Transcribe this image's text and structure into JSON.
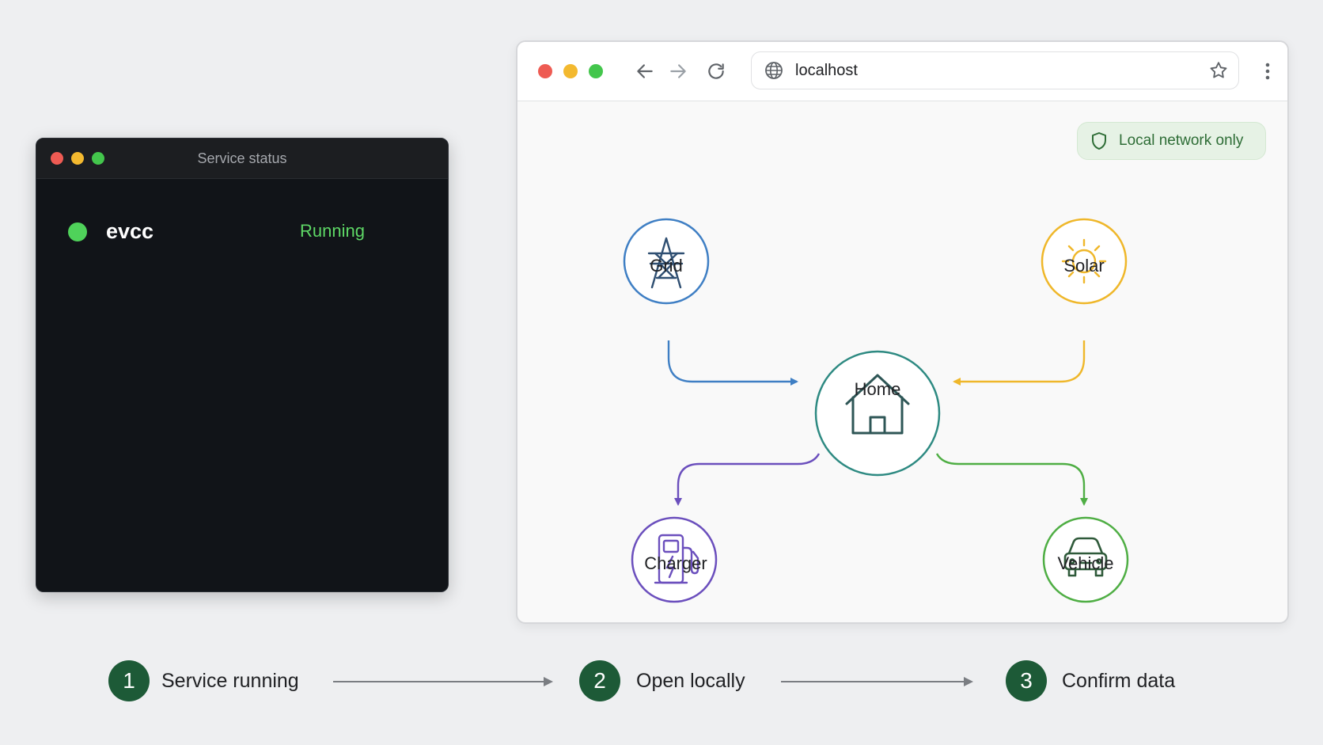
{
  "terminal": {
    "title": "Service status",
    "service": {
      "name": "evcc",
      "status": "Running",
      "status_color": "#5ed866"
    }
  },
  "browser": {
    "url": "localhost",
    "icons": [
      "back-arrow-icon",
      "forward-arrow-icon",
      "reload-icon",
      "globe-icon",
      "star-icon",
      "more-vert-icon"
    ],
    "badge": {
      "text": "Local network only",
      "icon": "shield-icon",
      "color": "#2e6d36"
    },
    "diagram": {
      "nodes": [
        {
          "id": "grid",
          "label": "Grid",
          "icon": "power-tower-icon",
          "color": "#3f7fc4"
        },
        {
          "id": "solar",
          "label": "Solar",
          "icon": "sun-icon",
          "color": "#efb72a"
        },
        {
          "id": "home",
          "label": "Home",
          "icon": "house-icon",
          "color": "#2e8a82"
        },
        {
          "id": "charger",
          "label": "Charger",
          "icon": "ev-charger-icon",
          "color": "#6b4fbd"
        },
        {
          "id": "vehicle",
          "label": "Vehicle",
          "icon": "car-icon",
          "color": "#4fae44"
        }
      ],
      "flows": [
        {
          "from": "grid",
          "to": "home"
        },
        {
          "from": "solar",
          "to": "home"
        },
        {
          "from": "home",
          "to": "charger"
        },
        {
          "from": "home",
          "to": "vehicle"
        }
      ]
    }
  },
  "steps": [
    {
      "number": "1",
      "label": "Service running"
    },
    {
      "number": "2",
      "label": "Open locally"
    },
    {
      "number": "3",
      "label": "Confirm data"
    }
  ],
  "colors": {
    "background": "#eeeff1",
    "step_badge": "#1d5a37",
    "terminal_bg": "#111418"
  }
}
